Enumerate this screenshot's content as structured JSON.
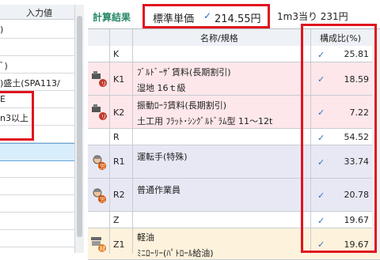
{
  "left_panel": {
    "header": "入力値",
    "rows": [
      ")",
      "ﾞ)",
      ")盛土(SPA113/",
      "E",
      "n3以上",
      "",
      "",
      ""
    ],
    "selected_index": 6
  },
  "result": {
    "title": "計算結果",
    "std_label": "標準単価",
    "std_value": "214.55円",
    "per_unit": "1m3当り  231円"
  },
  "grid": {
    "col_name": "名称/規格",
    "col_ratio": "構成比(%)",
    "rows": [
      {
        "code": "K",
        "line1": "",
        "line2": "",
        "checked": true,
        "pct": "25.81",
        "bg": "#ffffff",
        "icon": ""
      },
      {
        "code": "K1",
        "line1": "ﾌﾞﾙﾄﾞｰｻﾞ賃料(長期割引)",
        "line2": "湿地 16ｔ級",
        "checked": true,
        "pct": "18.59",
        "bg": "#fde7ea",
        "icon": "machine-rental-icon"
      },
      {
        "code": "K2",
        "line1": "振動ﾛｰﾗ賃料(長期割引)",
        "line2": "土工用 ﾌﾗｯﾄ･ｼﾝｸﾞﾙﾄﾞﾗﾑ型 11～12t",
        "checked": true,
        "pct": "7.22",
        "bg": "#fde7ea",
        "icon": "machine-rental-icon"
      },
      {
        "code": "R",
        "line1": "",
        "line2": "",
        "checked": true,
        "pct": "54.52",
        "bg": "#ffffff",
        "icon": ""
      },
      {
        "code": "R1",
        "line1": "運転手(特殊)",
        "line2": "",
        "checked": true,
        "pct": "33.74",
        "bg": "#e8e8f5",
        "icon": "worker-icon"
      },
      {
        "code": "R2",
        "line1": "普通作業員",
        "line2": "",
        "checked": true,
        "pct": "20.78",
        "bg": "#e8e8f5",
        "icon": "worker-icon"
      },
      {
        "code": "Z",
        "line1": "",
        "line2": "",
        "checked": true,
        "pct": "19.67",
        "bg": "#ffffff",
        "icon": ""
      },
      {
        "code": "Z1",
        "line1": "軽油",
        "line2": "ﾐﾆﾛｰﾘｰ(ﾊﾟﾄﾛｰﾙ給油)",
        "checked": true,
        "pct": "19.67",
        "bg": "#fdf2dc",
        "icon": "fuel-material-icon"
      }
    ]
  },
  "colors": {
    "accent": "#2a8a6a",
    "highlight": "#e0141e",
    "check": "#2e6fc0"
  }
}
